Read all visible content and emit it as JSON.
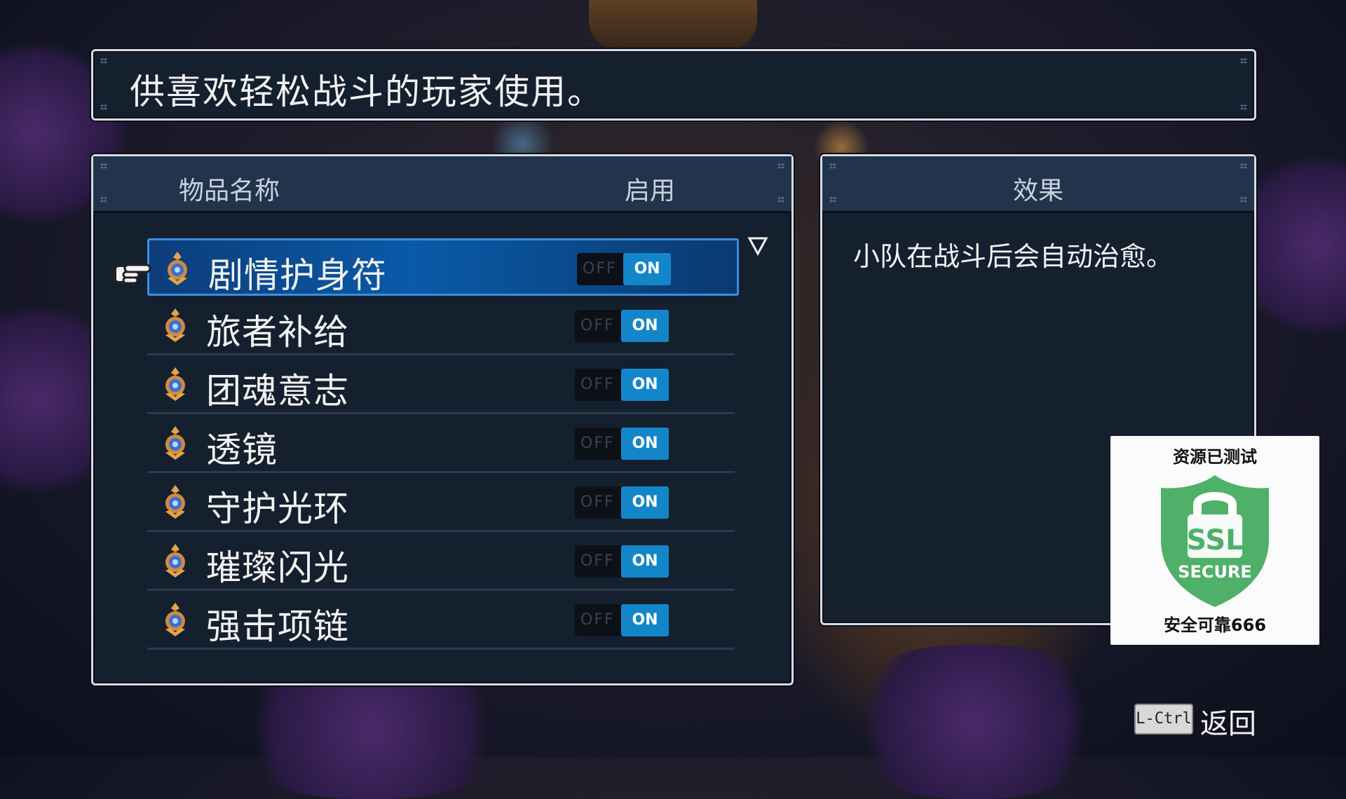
{
  "description": "供喜欢轻松战斗的玩家使用。",
  "list": {
    "header_name": "物品名称",
    "header_enable": "启用",
    "items": [
      {
        "label": "剧情护身符",
        "off": "OFF",
        "on": "ON",
        "enabled": true,
        "selected": true
      },
      {
        "label": "旅者补给",
        "off": "OFF",
        "on": "ON",
        "enabled": true
      },
      {
        "label": "团魂意志",
        "off": "OFF",
        "on": "ON",
        "enabled": true
      },
      {
        "label": "透镜",
        "off": "OFF",
        "on": "ON",
        "enabled": true
      },
      {
        "label": "守护光环",
        "off": "OFF",
        "on": "ON",
        "enabled": true
      },
      {
        "label": "璀璨闪光",
        "off": "OFF",
        "on": "ON",
        "enabled": true
      },
      {
        "label": "强击项链",
        "off": "OFF",
        "on": "ON",
        "enabled": true
      }
    ]
  },
  "effect": {
    "header": "效果",
    "text": "小队在战斗后会自动治愈。"
  },
  "badge": {
    "title": "资源已测试",
    "shield_main": "SSL",
    "shield_sub": "SECURE",
    "footer": "安全可靠666",
    "color": "#4fb06a"
  },
  "footer": {
    "key": "L-Ctrl",
    "action": "返回"
  },
  "colors": {
    "panel_bg": "#15202f",
    "header_bg": "#22344b",
    "toggle_on": "#1386c9",
    "selection": "#0a5aa8"
  }
}
